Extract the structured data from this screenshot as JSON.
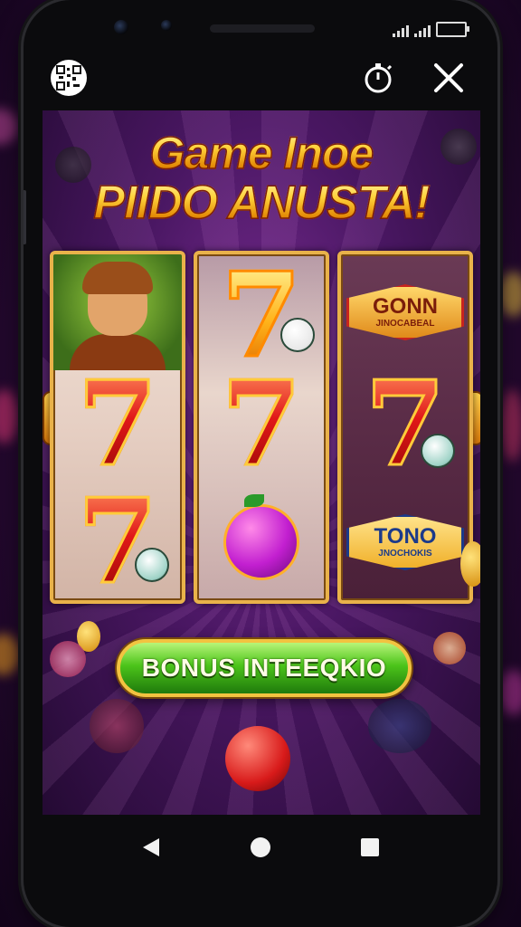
{
  "status_bar": {
    "battery_label": ""
  },
  "top_bar": {
    "qr_icon": "qr-code-icon",
    "timer_icon": "timer-icon",
    "close_icon": "close-icon"
  },
  "ad": {
    "title_line1": "Game Inoe",
    "title_line2": "PIIDO ANUSTA!",
    "reels": [
      {
        "symbols": [
          "character-portrait",
          "red-seven",
          "red-seven"
        ]
      },
      {
        "symbols": [
          "gold-seven",
          "red-seven",
          "plum-fruit"
        ]
      },
      {
        "symbols": [
          "gonn-emblem",
          "red-seven",
          "tono-emblem"
        ]
      }
    ],
    "emblem_top": {
      "main": "GONN",
      "sub": "JINOCABEAL"
    },
    "emblem_bottom": {
      "main": "TONO",
      "sub": "JNOCHOKIS"
    },
    "bonus_button": "BONUS INTEEQKIO"
  },
  "nav_bar": {
    "back_icon": "back-triangle-icon",
    "home_icon": "home-circle-icon",
    "recents_icon": "recents-square-icon"
  },
  "colors": {
    "background": "#2a0a36",
    "title_gold": "#ffd23a",
    "button_green": "#4cc41a",
    "seven_red": "#e01818"
  }
}
